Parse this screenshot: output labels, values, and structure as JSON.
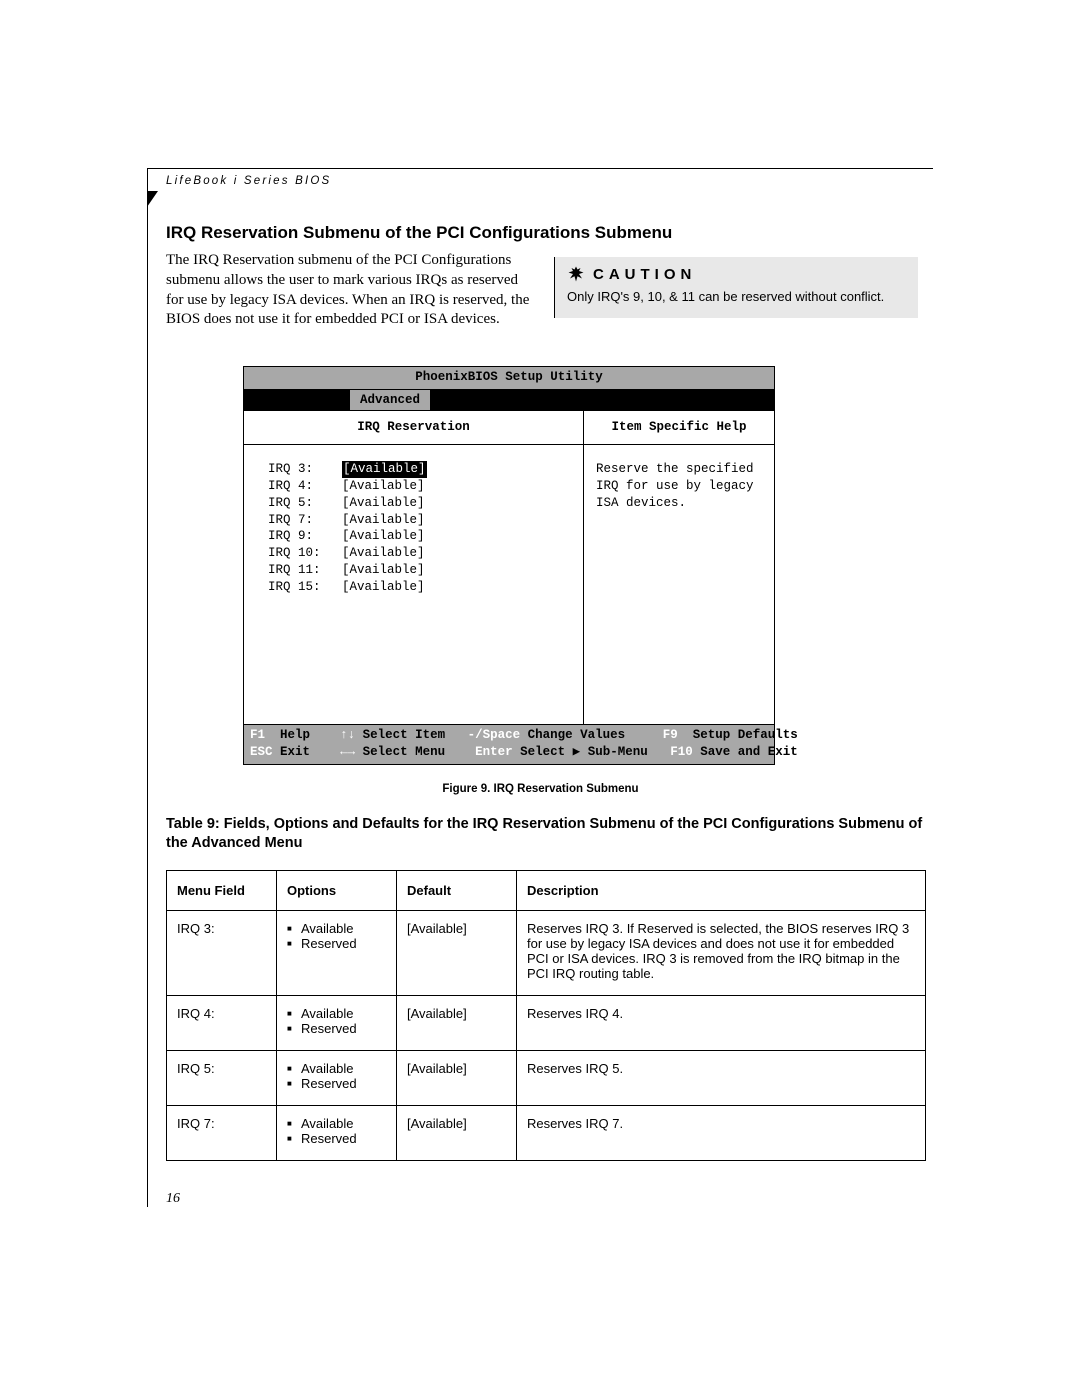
{
  "running_header": "LifeBook i Series BIOS",
  "section_title": "IRQ Reservation Submenu of the PCI Configurations Submenu",
  "intro_text": "The IRQ Reservation submenu of the PCI Configurations submenu allows the user to mark various IRQs as reserved for use by legacy ISA devices. When an IRQ is reserved, the BIOS does not use it for embedded PCI or ISA devices.",
  "caution": {
    "label": "CAUTION",
    "text": "Only IRQ's 9, 10, & 11 can be reserved without conflict."
  },
  "bios": {
    "title": "PhoenixBIOS Setup Utility",
    "active_tab": "Advanced",
    "left_header": "IRQ Reservation",
    "right_header": "Item Specific Help",
    "help_text": "Reserve the specified IRQ for use by legacy ISA devices.",
    "irq_rows": [
      {
        "label": "IRQ 3:",
        "value": "[Available]",
        "selected": true
      },
      {
        "label": "IRQ 4:",
        "value": "[Available]",
        "selected": false
      },
      {
        "label": "IRQ 5:",
        "value": "[Available]",
        "selected": false
      },
      {
        "label": "IRQ 7:",
        "value": "[Available]",
        "selected": false
      },
      {
        "label": "IRQ 9:",
        "value": "[Available]",
        "selected": false
      },
      {
        "label": "IRQ 10:",
        "value": "[Available]",
        "selected": false
      },
      {
        "label": "IRQ 11:",
        "value": "[Available]",
        "selected": false
      },
      {
        "label": "IRQ 15:",
        "value": "[Available]",
        "selected": false
      }
    ],
    "footer": {
      "f1": "F1",
      "f1_label": "Help",
      "arrows_v": "↑↓",
      "arrows_v_label": "Select Item",
      "minus_space": "-/Space",
      "minus_space_label": "Change Values",
      "f9": "F9",
      "f9_label": "Setup Defaults",
      "esc": "ESC",
      "esc_label": "Exit",
      "arrows_h": "←→",
      "arrows_h_label": "Select Menu",
      "enter": "Enter",
      "enter_label": "Select ▶ Sub-Menu",
      "f10": "F10",
      "f10_label": "Save and Exit"
    }
  },
  "figure_caption": "Figure 9.  IRQ Reservation Submenu",
  "table_title": "Table 9: Fields, Options and Defaults for the IRQ Reservation Submenu of the PCI Configurations Submenu of the Advanced Menu",
  "table": {
    "headers": [
      "Menu Field",
      "Options",
      "Default",
      "Description"
    ],
    "rows": [
      {
        "menu_field": "IRQ 3:",
        "options": [
          "Available",
          "Reserved"
        ],
        "default": "[Available]",
        "description": "Reserves IRQ 3. If Reserved is selected, the BIOS reserves IRQ 3 for use by legacy ISA devices and does not use it for embedded PCI or ISA devices. IRQ 3 is removed from the IRQ bitmap in the PCI IRQ routing table."
      },
      {
        "menu_field": "IRQ 4:",
        "options": [
          "Available",
          "Reserved"
        ],
        "default": "[Available]",
        "description": "Reserves IRQ 4."
      },
      {
        "menu_field": "IRQ 5:",
        "options": [
          "Available",
          "Reserved"
        ],
        "default": "[Available]",
        "description": "Reserves IRQ 5."
      },
      {
        "menu_field": "IRQ 7:",
        "options": [
          "Available",
          "Reserved"
        ],
        "default": "[Available]",
        "description": "Reserves IRQ 7."
      }
    ]
  },
  "page_number": "16"
}
